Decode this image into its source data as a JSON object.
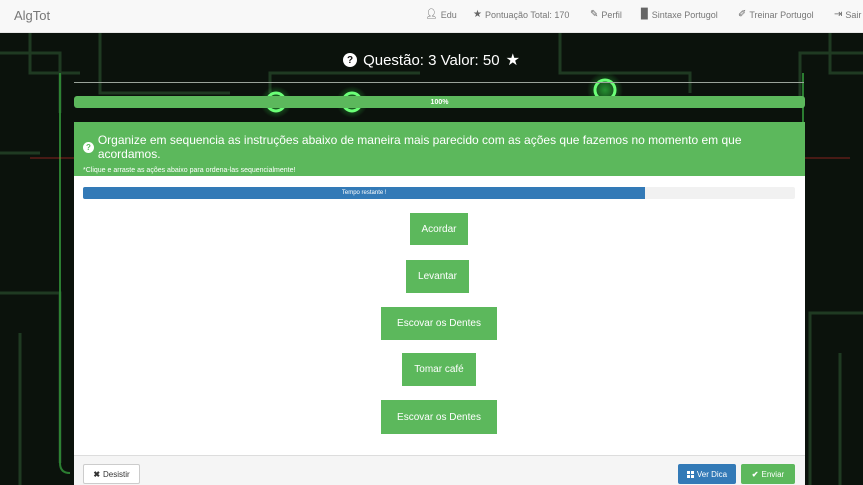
{
  "navbar": {
    "brand": "AlgTot",
    "user_label": "Edu",
    "score_label": "Pontuação Total: 170",
    "profile_label": "Perfil",
    "syntax_label": "Sintaxe Portugol",
    "train_label": "Treinar Portugol",
    "logout_label": "Sair"
  },
  "question": {
    "title": "Questão: 3 Valor: 50",
    "progress_text": "100%",
    "progress_percent": 100,
    "instruction": "Organize em sequencia as instruções abaixo de maneira mais parecido com as ações que fazemos no momento em que acordamos.",
    "hint": "*Clique e arraste as ações abaixo para ordena-las sequencialmente!"
  },
  "timer": {
    "label": "Tempo restante !",
    "fraction": 0.79
  },
  "actions": [
    "Acordar",
    "Levantar",
    "Escovar os Dentes",
    "Tomar café",
    "Escovar os Dentes"
  ],
  "footer": {
    "desistir_label": "Desistir",
    "dica_label": "Ver Dica",
    "enviar_label": "Enviar"
  },
  "colors": {
    "success": "#5cb85c",
    "primary": "#337ab7",
    "background": "#0b120c"
  }
}
